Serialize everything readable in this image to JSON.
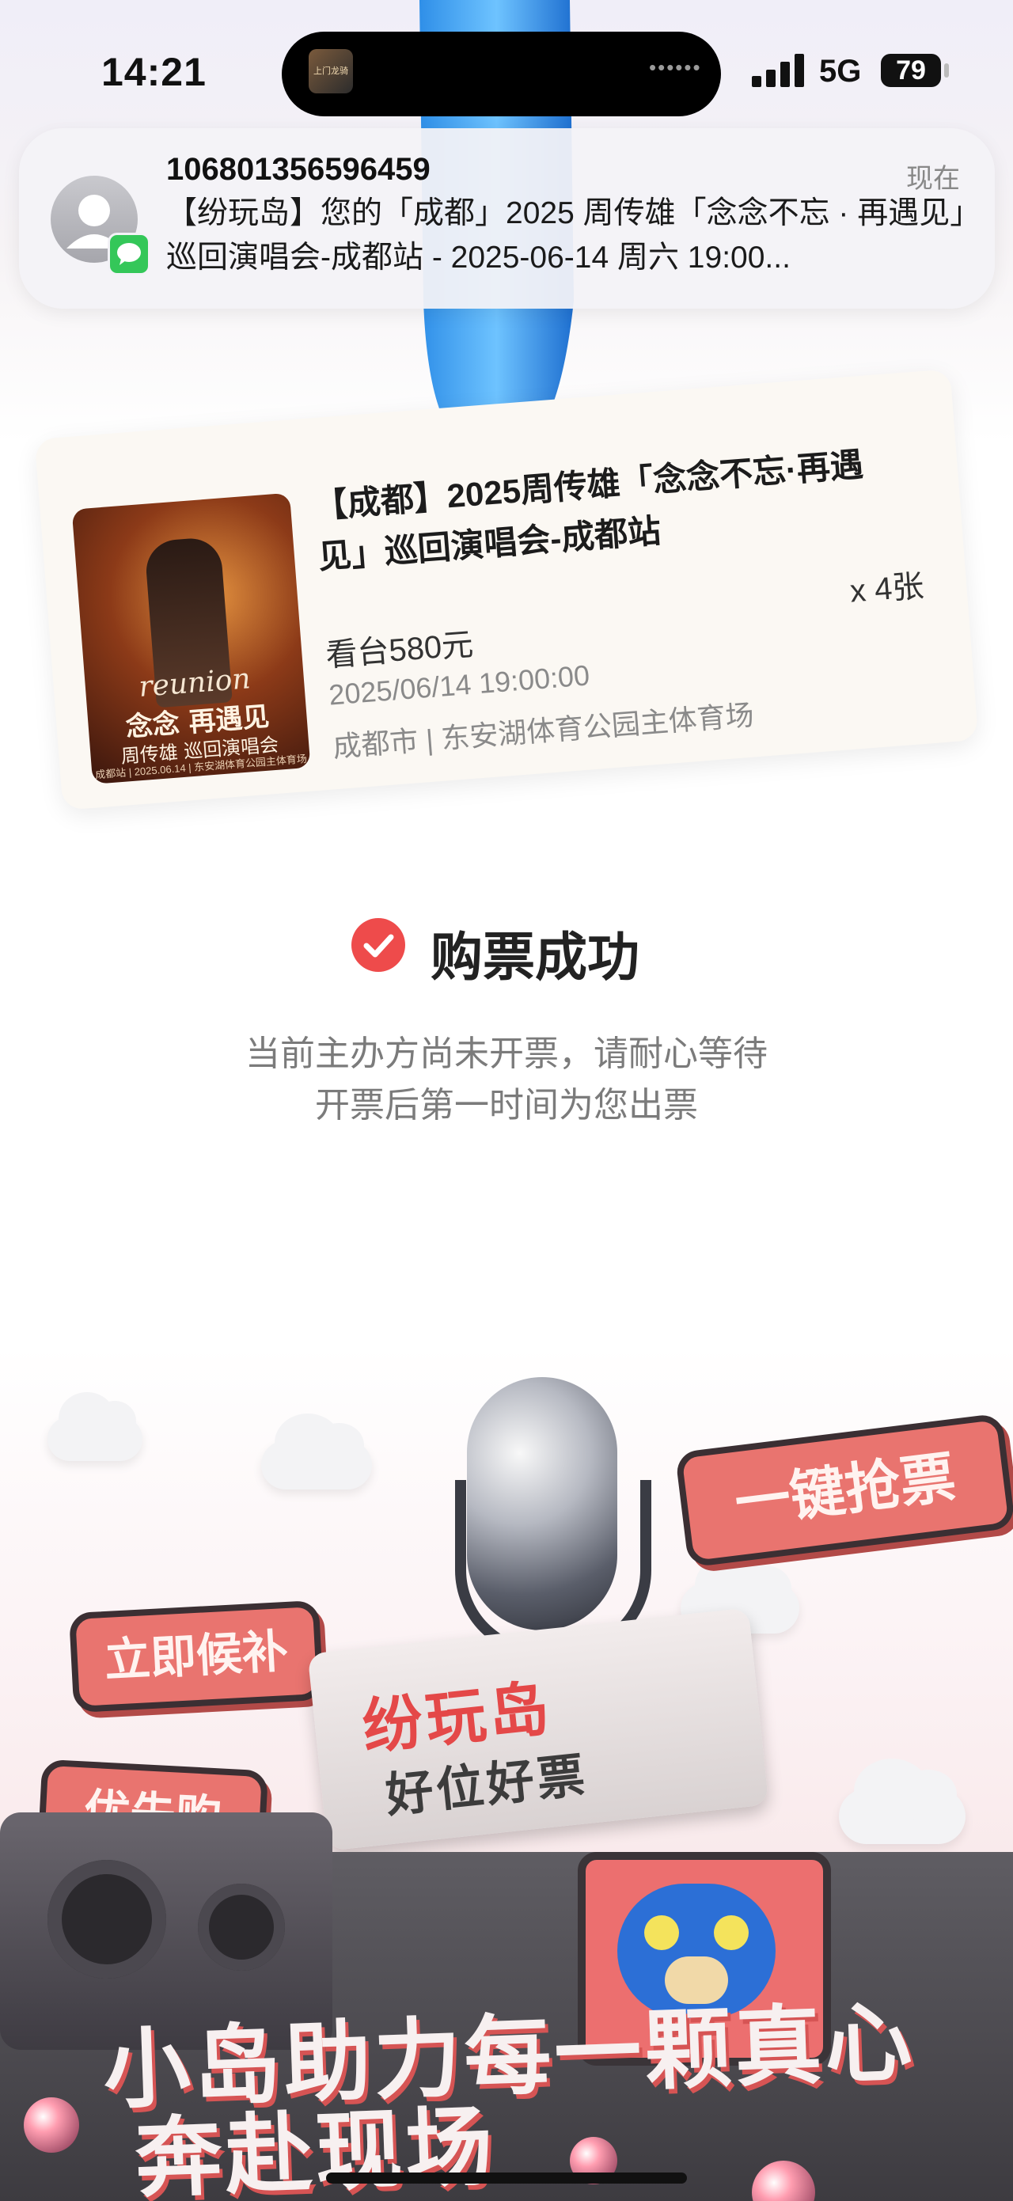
{
  "status_bar": {
    "time": "14:21",
    "island_art_text": "上门龙骑",
    "island_dots": "••••••",
    "network": "5G",
    "battery": "79"
  },
  "notification": {
    "sender": "106801356596459",
    "time": "现在",
    "body": "【纷玩岛】您的「成都」2025 周传雄「念念不忘 · 再遇见」巡回演唱会-成都站 - 2025-06-14 周六 19:00..."
  },
  "ticket": {
    "title": "【成都】2025周传雄「念念不忘·再遇见」巡回演唱会-成都站",
    "quantity": "x 4张",
    "price": "看台580元",
    "datetime": "2025/06/14 19:00:00",
    "venue": "成都市 | 东安湖体育公园主体育场",
    "poster": {
      "en": "reunion",
      "zh_title": "念念 再遇见",
      "zh_artist": "周传雄 巡回演唱会",
      "footer": "成都站 | 2025.06.14 | 东安湖体育公园主体育场"
    }
  },
  "result": {
    "title": "购票成功",
    "line1": "当前主办方尚未开票，请耐心等待",
    "line2": "开票后第一时间为您出票"
  },
  "promo": {
    "bubble_1": "一键抢票",
    "bubble_2": "立即候补",
    "bubble_3": "优先购",
    "marquee_title": "纷玩岛",
    "marquee_sub": "好位好票",
    "slogan_1": "小岛助力每一颗真心",
    "slogan_2": "奔赴现场"
  },
  "colors": {
    "accent_red": "#ee4b4b",
    "bubble_red": "#e9746f",
    "notif_green": "#34c759"
  }
}
